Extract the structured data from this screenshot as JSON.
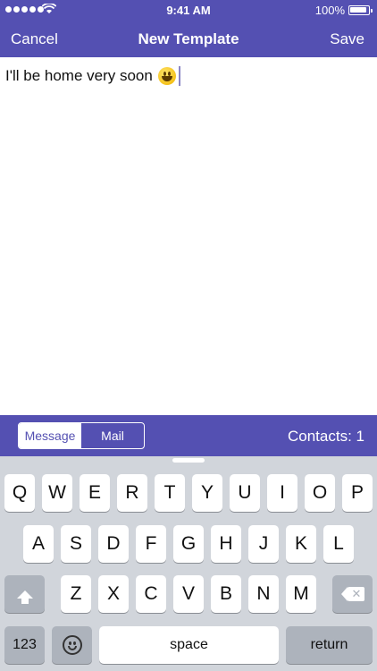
{
  "status_bar": {
    "time": "9:41 AM",
    "battery_percent": "100%",
    "battery_level": 1.0
  },
  "nav": {
    "cancel_label": "Cancel",
    "title": "New Template",
    "save_label": "Save"
  },
  "editor": {
    "text": "I'll be home very soon",
    "emoji_icon": "grinning-face-emoji"
  },
  "toolbar": {
    "segments": [
      {
        "label": "Message",
        "selected": true
      },
      {
        "label": "Mail",
        "selected": false
      }
    ],
    "contacts_label": "Contacts: 1"
  },
  "colors": {
    "accent": "#5450b2",
    "keyboard_bg": "#d1d5db",
    "function_key": "#adb3bc"
  },
  "keyboard": {
    "row1": [
      "Q",
      "W",
      "E",
      "R",
      "T",
      "Y",
      "U",
      "I",
      "O",
      "P"
    ],
    "row2": [
      "A",
      "S",
      "D",
      "F",
      "G",
      "H",
      "J",
      "K",
      "L"
    ],
    "row3": [
      "Z",
      "X",
      "C",
      "V",
      "B",
      "N",
      "M"
    ],
    "numbers_label": "123",
    "space_label": "space",
    "return_label": "return",
    "shift_icon": "shift-arrow-icon",
    "backspace_icon": "backspace-icon",
    "emoji_icon": "emoji-face-icon"
  }
}
